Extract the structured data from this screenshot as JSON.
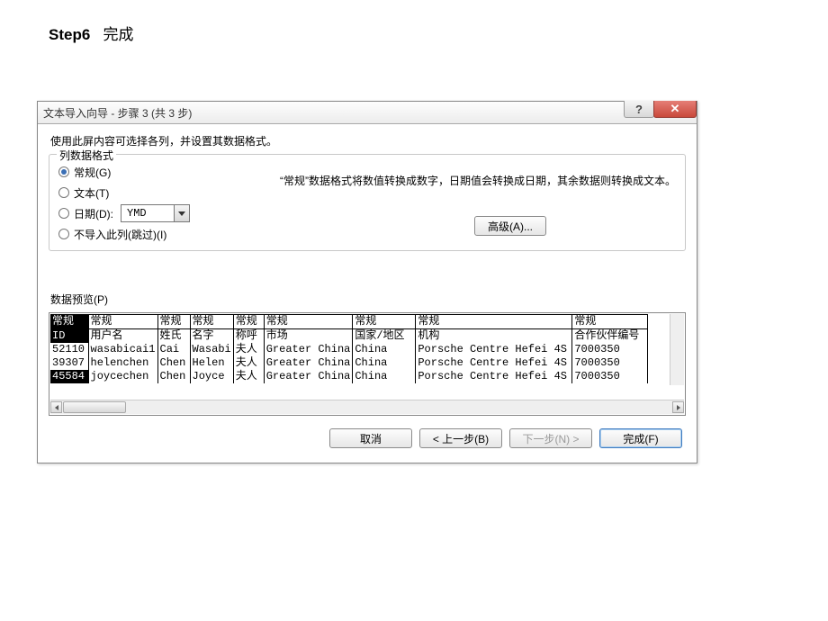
{
  "page": {
    "step_label": "Step6",
    "step_title": "完成"
  },
  "dialog": {
    "title": "文本导入向导 - 步骤 3 (共 3 步)",
    "instruction": "使用此屏内容可选择各列，并设置其数据格式。",
    "format_group_label": "列数据格式",
    "options": {
      "general": "常规(G)",
      "text": "文本(T)",
      "date": "日期(D):",
      "date_value": "YMD",
      "skip": "不导入此列(跳过)(I)"
    },
    "explain": "“常规”数据格式将数值转换成数字，日期值会转换成日期，其余数据则转换成文本。",
    "advanced_btn": "高级(A)...",
    "preview_label": "数据预览(P)",
    "buttons": {
      "cancel": "取消",
      "back": "< 上一步(B)",
      "next": "下一步(N) >",
      "finish": "完成(F)"
    }
  },
  "preview": {
    "format_row": [
      "常规",
      "常规",
      "常规",
      "常规",
      "常规",
      "常规",
      "常规",
      "常规",
      "常规"
    ],
    "header_row": [
      "ID",
      "用户名",
      "姓氏",
      "名字",
      "称呼",
      "市场",
      "国家/地区",
      "机构",
      "合作伙伴编号"
    ],
    "rows": [
      [
        "52110",
        "wasabicai1",
        "Cai",
        "Wasabi",
        "夫人",
        "Greater China",
        "China",
        "Porsche Centre Hefei 4S",
        "7000350"
      ],
      [
        "39307",
        "helenchen",
        "Chen",
        "Helen",
        "夫人",
        "Greater China",
        "China",
        "Porsche Centre Hefei 4S",
        "7000350"
      ],
      [
        "45584",
        "joycechen",
        "Chen",
        "Joyce",
        "夫人",
        "Greater China",
        "China",
        "Porsche Centre Hefei 4S",
        "7000350"
      ]
    ],
    "selected_rows": [
      0,
      3
    ]
  }
}
